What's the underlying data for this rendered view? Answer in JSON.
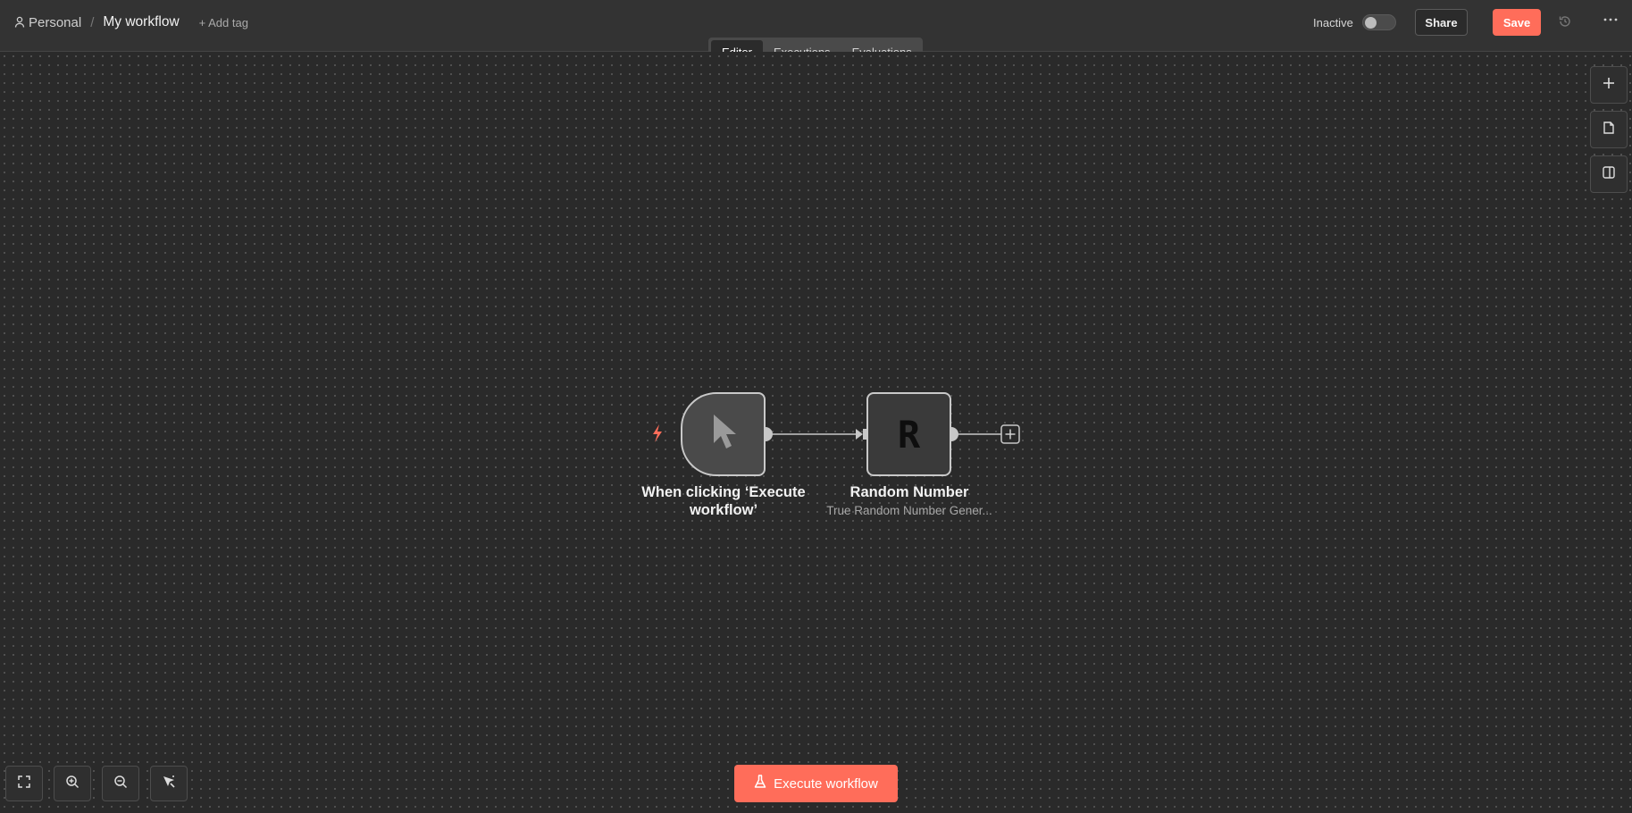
{
  "breadcrumb": {
    "personal": "Personal",
    "separator": "/",
    "workflow_name": "My workflow",
    "add_tag": "+ Add tag"
  },
  "header": {
    "status": "Inactive",
    "share": "Share",
    "save": "Save"
  },
  "tabs": [
    {
      "label": "Editor",
      "active": true
    },
    {
      "label": "Executions",
      "active": false
    },
    {
      "label": "Evaluations",
      "active": false
    }
  ],
  "nodes": {
    "trigger": {
      "label": "When clicking ‘Execute workflow’",
      "icon": "cursor-icon"
    },
    "random": {
      "label": "Random Number",
      "subtitle": "True Random Number Gener...",
      "icon_letter": "R"
    }
  },
  "execute_button": {
    "label": "Execute workflow",
    "icon": "flask-icon"
  },
  "colors": {
    "accent": "#ff6d5a",
    "canvas": "#2a2a2a",
    "header": "#333333"
  }
}
